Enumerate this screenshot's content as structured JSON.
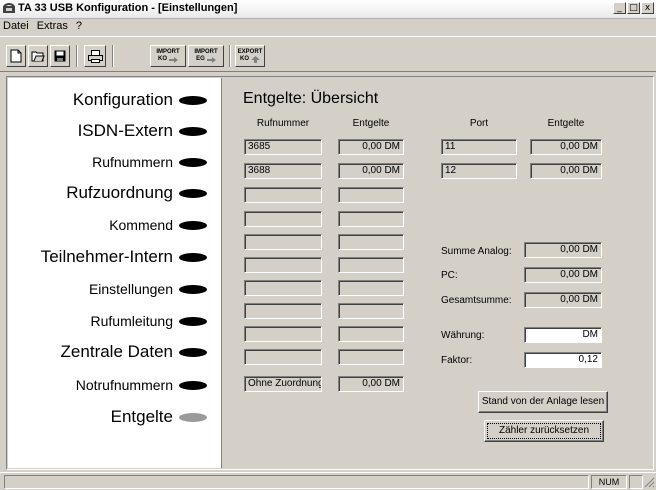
{
  "window": {
    "title": "TA 33 USB Konfiguration - [Einstellungen]",
    "controls": [
      "_",
      "□",
      "x"
    ]
  },
  "menu": [
    "Datei",
    "Extras",
    "?"
  ],
  "toolbar": {
    "import_ko": [
      "IMPORT",
      "KO"
    ],
    "import_eg": [
      "IMPORT",
      "EG"
    ],
    "export_ko": [
      "EXPORT",
      "KO"
    ]
  },
  "nav": [
    {
      "label": "Konfiguration",
      "size": "big"
    },
    {
      "label": "ISDN-Extern",
      "size": "big"
    },
    {
      "label": "Rufnummern",
      "size": "small"
    },
    {
      "label": "Rufzuordnung",
      "size": "big"
    },
    {
      "label": "Kommend",
      "size": "small"
    },
    {
      "label": "Teilnehmer-Intern",
      "size": "big"
    },
    {
      "label": "Einstellungen",
      "size": "small"
    },
    {
      "label": "Rufumleitung",
      "size": "small"
    },
    {
      "label": "Zentrale Daten",
      "size": "big"
    },
    {
      "label": "Notrufnummern",
      "size": "small"
    },
    {
      "label": "Entgelte",
      "size": "big",
      "active": true
    }
  ],
  "main": {
    "heading": "Entgelte: Übersicht",
    "col_rufnummer": "Rufnummer",
    "col_entgelte": "Entgelte",
    "col_port": "Port",
    "col_port_entgelte": "Entgelte",
    "rows": [
      {
        "nummer": "3685",
        "entgelt": "0,00 DM"
      },
      {
        "nummer": "3688",
        "entgelt": "0,00 DM"
      },
      {
        "nummer": "",
        "entgelt": ""
      },
      {
        "nummer": "",
        "entgelt": ""
      },
      {
        "nummer": "",
        "entgelt": ""
      },
      {
        "nummer": "",
        "entgelt": ""
      },
      {
        "nummer": "",
        "entgelt": ""
      },
      {
        "nummer": "",
        "entgelt": ""
      },
      {
        "nummer": "",
        "entgelt": ""
      },
      {
        "nummer": "",
        "entgelt": ""
      },
      {
        "nummer": "Ohne Zuordnung",
        "entgelt": "0,00 DM"
      }
    ],
    "ports": [
      {
        "port": "11",
        "entgelt": "0,00 DM"
      },
      {
        "port": "12",
        "entgelt": "0,00 DM"
      }
    ],
    "summe_analog_label": "Summe Analog:",
    "summe_analog": "0,00 DM",
    "pc_label": "PC:",
    "pc": "0,00 DM",
    "gesamt_label": "Gesamtsumme:",
    "gesamt": "0,00 DM",
    "waehrung_label": "Währung:",
    "waehrung": "DM",
    "faktor_label": "Faktor:",
    "faktor": "0,12",
    "btn_stand": "Stand von der Anlage lesen",
    "btn_reset": "Zähler zurücksetzen"
  },
  "status": {
    "num": "NUM"
  }
}
